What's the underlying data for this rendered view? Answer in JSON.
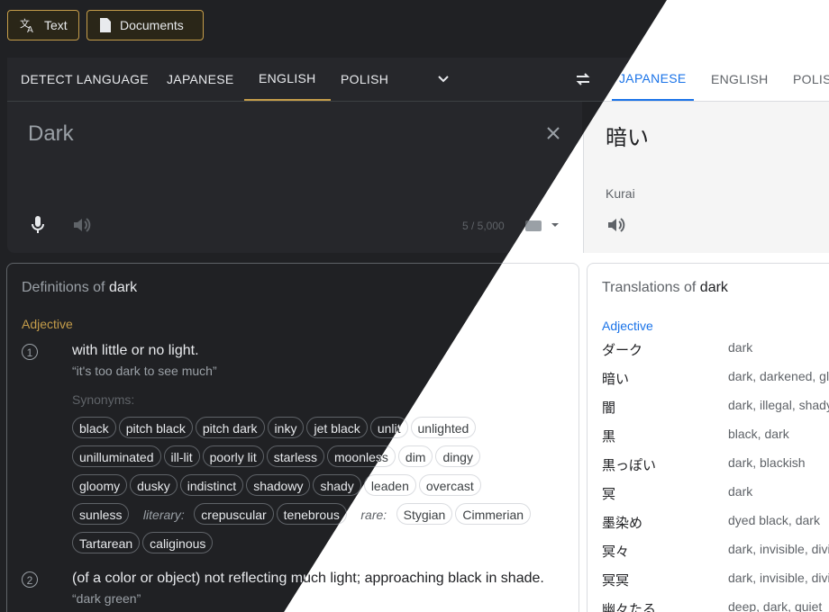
{
  "modes": {
    "text_label": "Text",
    "documents_label": "Documents"
  },
  "source_langs": [
    "DETECT LANGUAGE",
    "JAPANESE",
    "ENGLISH",
    "POLISH"
  ],
  "target_langs": [
    "JAPANESE",
    "ENGLISH",
    "POLIS"
  ],
  "input": {
    "text": "Dark",
    "counter": "5 / 5,000"
  },
  "output": {
    "text": "暗い",
    "romanization": "Kurai"
  },
  "definitions": {
    "heading_prefix": "Definitions of ",
    "heading_word": "dark",
    "pos": "Adjective",
    "sense1": {
      "number": "1",
      "gloss": "with little or no light.",
      "example": "“it's too dark to see much”",
      "synonyms_label": "Synonyms:"
    },
    "syn_row1": [
      "black",
      "pitch black",
      "pitch dark",
      "inky",
      "jet black",
      "unlit",
      "unlighted"
    ],
    "syn_row2": [
      "unilluminated",
      "ill-lit",
      "poorly lit",
      "starless",
      "moonless",
      "dim",
      "dingy"
    ],
    "syn_row3": [
      "gloomy",
      "dusky",
      "indistinct",
      "shadowy",
      "shady",
      "leaden",
      "overcast"
    ],
    "syn_row4_a": "sunless",
    "literary_label": "literary:",
    "syn_row4_b": [
      "crepuscular",
      "tenebrous"
    ],
    "rare_label": "rare:",
    "syn_row4_c": [
      "Stygian",
      "Cimmerian"
    ],
    "syn_row5": [
      "Tartarean",
      "caliginous"
    ],
    "sense2": {
      "number": "2",
      "gloss": "(of a color or object) not reflecting much light; approaching black in shade.",
      "example": "“dark green”"
    }
  },
  "translations": {
    "heading_prefix": "Translations of ",
    "heading_word": "dark",
    "pos": "Adjective",
    "rows": [
      {
        "word": "ダーク",
        "meaning": "dark"
      },
      {
        "word": "暗い",
        "meaning": "dark, darkened, gl"
      },
      {
        "word": "闇",
        "meaning": "dark, illegal, shady"
      },
      {
        "word": "黒",
        "meaning": "black, dark"
      },
      {
        "word": "黒っぽい",
        "meaning": "dark, blackish"
      },
      {
        "word": "冥",
        "meaning": "dark"
      },
      {
        "word": "墨染め",
        "meaning": "dyed black, dark"
      },
      {
        "word": "冥々",
        "meaning": "dark, invisible, divi"
      },
      {
        "word": "冥冥",
        "meaning": "dark, invisible, divi"
      },
      {
        "word": "幽々たる",
        "meaning": "deep, dark, quiet"
      }
    ]
  },
  "colors": {
    "dark_bg": "#202124",
    "gold_accent": "#c59d4a",
    "blue_accent": "#1a73e8"
  }
}
